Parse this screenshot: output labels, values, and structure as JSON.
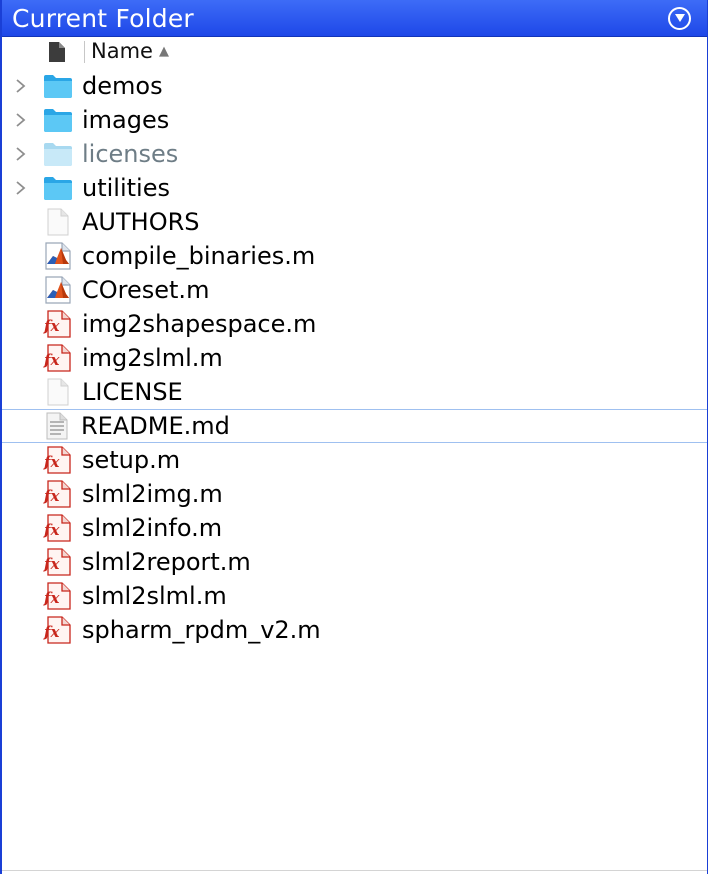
{
  "panel": {
    "title": "Current Folder",
    "menu_icon": "circle-down-arrow-icon"
  },
  "header": {
    "column_label": "Name",
    "sort": "ascending"
  },
  "rows": [
    {
      "name": "demos",
      "type": "folder",
      "expandable": true
    },
    {
      "name": "images",
      "type": "folder",
      "expandable": true
    },
    {
      "name": "licenses",
      "type": "folder",
      "expandable": true,
      "dimmed": true
    },
    {
      "name": "utilities",
      "type": "folder",
      "expandable": true
    },
    {
      "name": "AUTHORS",
      "type": "file"
    },
    {
      "name": "compile_binaries.m",
      "type": "script"
    },
    {
      "name": "COreset.m",
      "type": "script"
    },
    {
      "name": "img2shapespace.m",
      "type": "function"
    },
    {
      "name": "img2slml.m",
      "type": "function"
    },
    {
      "name": "LICENSE",
      "type": "file"
    },
    {
      "name": "README.md",
      "type": "text",
      "selected": true
    },
    {
      "name": "setup.m",
      "type": "function"
    },
    {
      "name": "slml2img.m",
      "type": "function"
    },
    {
      "name": "slml2info.m",
      "type": "function"
    },
    {
      "name": "slml2report.m",
      "type": "function"
    },
    {
      "name": "slml2slml.m",
      "type": "function"
    },
    {
      "name": "spharm_rpdm_v2.m",
      "type": "function"
    }
  ],
  "colors": {
    "titlebar": "#1e48e8",
    "folder": "#35b6f0",
    "function_icon": "#c8261c",
    "selection_border": "#9fc0f0"
  }
}
